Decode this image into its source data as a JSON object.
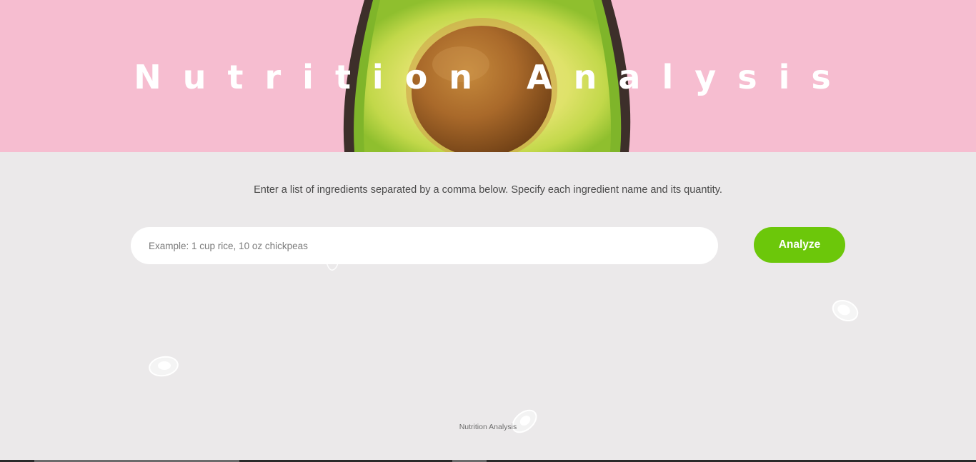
{
  "header": {
    "title": "Nutrition Analysis"
  },
  "main": {
    "instructions": "Enter a list of ingredients separated by a comma below. Specify each ingredient name and its quantity.",
    "search": {
      "value": "",
      "placeholder": "Example: 1 cup rice, 10 oz chickpeas"
    },
    "analyze_label": "Analyze"
  },
  "footer": {
    "text": "Nutrition Analysis"
  },
  "colors": {
    "hero_background": "#f6bdd0",
    "page_background": "#ebe9ea",
    "accent": "#6cc70a"
  },
  "icons": {
    "hero_image": "avocado-half-image",
    "decorations": "avocado-outline-icon"
  }
}
